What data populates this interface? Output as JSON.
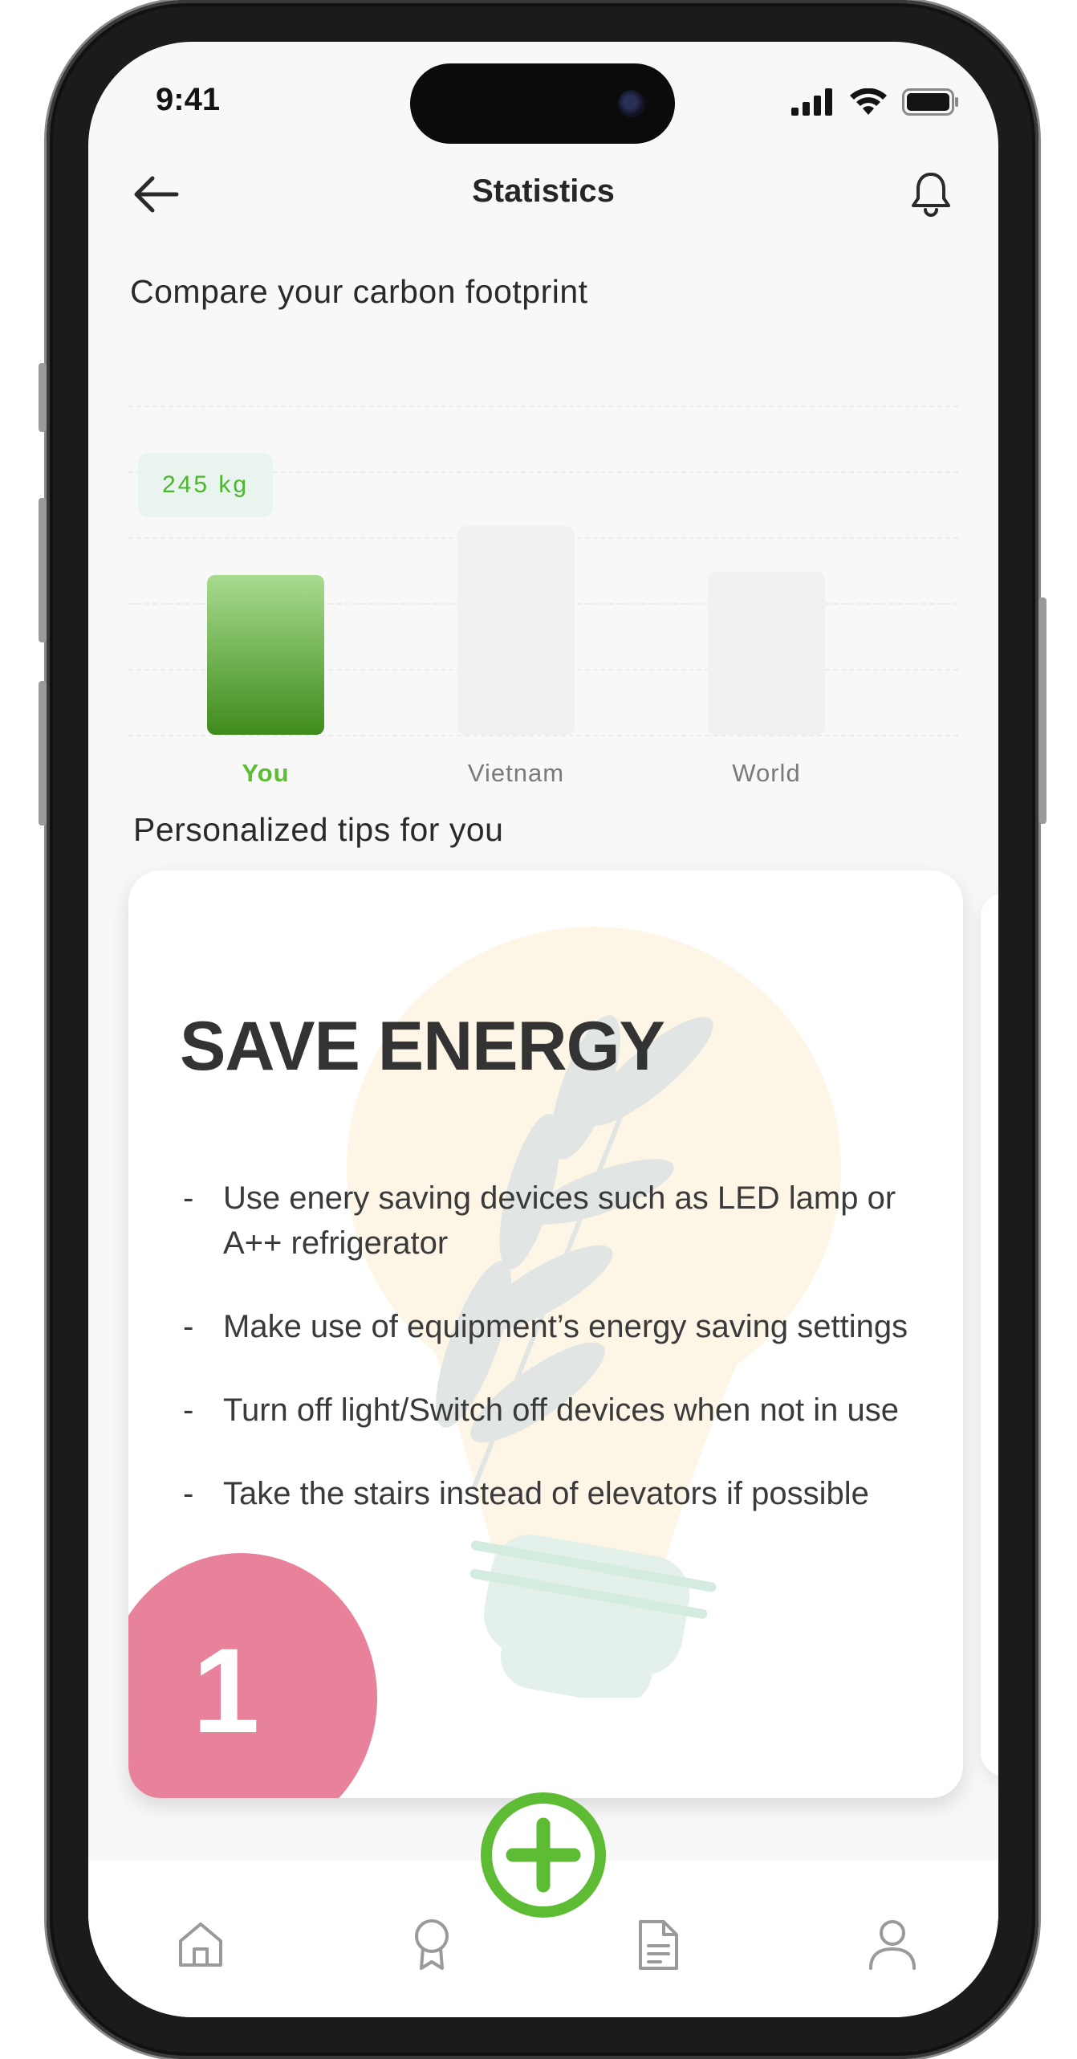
{
  "status_bar": {
    "time": "9:41"
  },
  "header": {
    "title": "Statistics"
  },
  "compare": {
    "title": "Compare your carbon footprint",
    "value_tag": "245 kg"
  },
  "chart_data": {
    "type": "bar",
    "categories": [
      "You",
      "Vietnam",
      "World"
    ],
    "values": [
      245,
      320,
      250
    ],
    "highlight": "You",
    "colors": {
      "highlight_top": "#a8dc8f",
      "highlight_bottom": "#3f8b1c",
      "others": "#f1f1f1",
      "label_active": "#5dbb34",
      "label_inactive": "#7a7a7a"
    }
  },
  "tips": {
    "section_title": "Personalized tips for you",
    "card": {
      "number": "1",
      "title": "SAVE ENERGY",
      "bullet": "-",
      "items": [
        "Use enery saving devices such as LED lamp or A++ refrigerator",
        "Make use of equipment’s energy saving settings",
        "Turn off light/Switch off devices when not in use",
        "Take the stairs instead of elevators if possible"
      ]
    }
  },
  "nav": {
    "items": [
      "home-icon",
      "award-icon",
      "document-icon",
      "profile-icon"
    ],
    "fab_icon": "plus-icon",
    "accent": "#5dbb34"
  }
}
